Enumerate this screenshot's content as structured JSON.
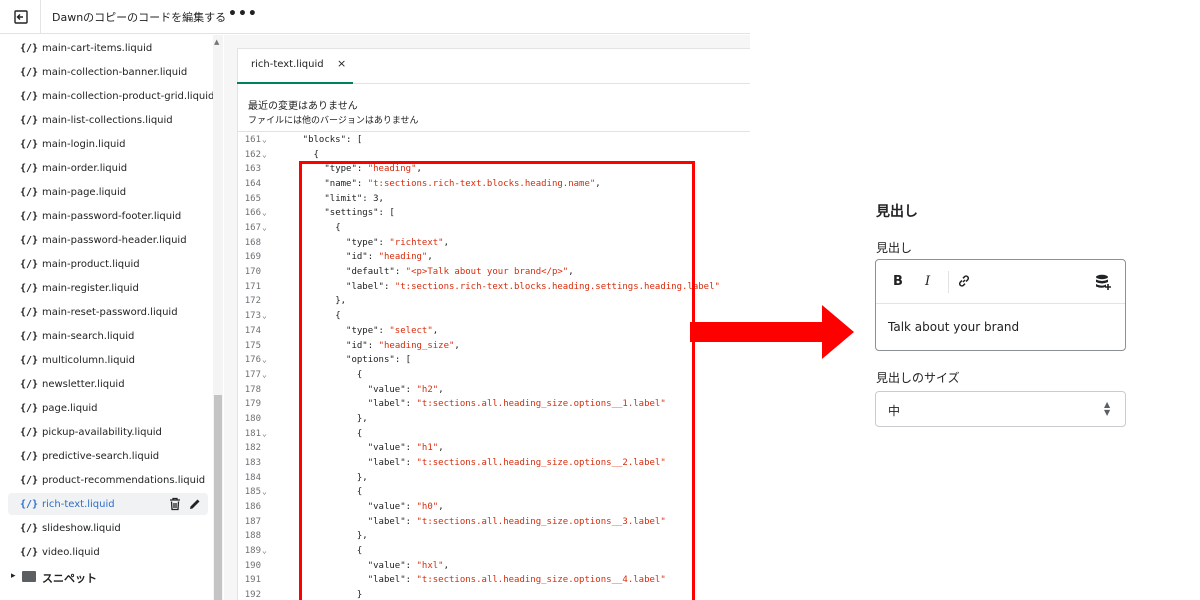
{
  "topbar": {
    "title": "Dawnのコピーのコードを編集する",
    "more": "•••"
  },
  "sidebar": {
    "files": [
      {
        "icon": "{/}",
        "label": "main-cart-items.liquid"
      },
      {
        "icon": "{/}",
        "label": "main-collection-banner.liquid"
      },
      {
        "icon": "{/}",
        "label": "main-collection-product-grid.liquid"
      },
      {
        "icon": "{/}",
        "label": "main-list-collections.liquid"
      },
      {
        "icon": "{/}",
        "label": "main-login.liquid"
      },
      {
        "icon": "{/}",
        "label": "main-order.liquid"
      },
      {
        "icon": "{/}",
        "label": "main-page.liquid"
      },
      {
        "icon": "{/}",
        "label": "main-password-footer.liquid"
      },
      {
        "icon": "{/}",
        "label": "main-password-header.liquid"
      },
      {
        "icon": "{/}",
        "label": "main-product.liquid"
      },
      {
        "icon": "{/}",
        "label": "main-register.liquid"
      },
      {
        "icon": "{/}",
        "label": "main-reset-password.liquid"
      },
      {
        "icon": "{/}",
        "label": "main-search.liquid"
      },
      {
        "icon": "{/}",
        "label": "multicolumn.liquid"
      },
      {
        "icon": "{/}",
        "label": "newsletter.liquid"
      },
      {
        "icon": "{/}",
        "label": "page.liquid"
      },
      {
        "icon": "{/}",
        "label": "pickup-availability.liquid"
      },
      {
        "icon": "{/}",
        "label": "predictive-search.liquid"
      },
      {
        "icon": "{/}",
        "label": "product-recommendations.liquid"
      },
      {
        "icon": "{/}",
        "label": "rich-text.liquid",
        "active": true
      },
      {
        "icon": "{/}",
        "label": "slideshow.liquid"
      },
      {
        "icon": "{/}",
        "label": "video.liquid"
      }
    ],
    "folder": {
      "label": "スニペット",
      "caret": "▸"
    }
  },
  "editor": {
    "tab_label": "rich-text.liquid",
    "tab_close": "×",
    "notice_title": "最近の変更はありません",
    "notice_sub": "ファイルには他のバージョンはありません",
    "lines": [
      {
        "n": "161",
        "fold": true,
        "indent": 4,
        "parts": [
          [
            "k",
            "\"blocks\""
          ],
          [
            "p",
            ": ["
          ]
        ]
      },
      {
        "n": "162",
        "fold": true,
        "indent": 6,
        "parts": [
          [
            "p",
            "{"
          ]
        ]
      },
      {
        "n": "163",
        "fold": false,
        "indent": 8,
        "parts": [
          [
            "k",
            "\"type\""
          ],
          [
            "p",
            ": "
          ],
          [
            "s",
            "\"heading\""
          ],
          [
            "p",
            ","
          ]
        ]
      },
      {
        "n": "164",
        "fold": false,
        "indent": 8,
        "parts": [
          [
            "k",
            "\"name\""
          ],
          [
            "p",
            ": "
          ],
          [
            "s",
            "\"t:sections.rich-text.blocks.heading.name\""
          ],
          [
            "p",
            ","
          ]
        ]
      },
      {
        "n": "165",
        "fold": false,
        "indent": 8,
        "parts": [
          [
            "k",
            "\"limit\""
          ],
          [
            "p",
            ": 3,"
          ]
        ]
      },
      {
        "n": "166",
        "fold": true,
        "indent": 8,
        "parts": [
          [
            "k",
            "\"settings\""
          ],
          [
            "p",
            ": ["
          ]
        ]
      },
      {
        "n": "167",
        "fold": true,
        "indent": 10,
        "parts": [
          [
            "p",
            "{"
          ]
        ]
      },
      {
        "n": "168",
        "fold": false,
        "indent": 12,
        "parts": [
          [
            "k",
            "\"type\""
          ],
          [
            "p",
            ": "
          ],
          [
            "s",
            "\"richtext\""
          ],
          [
            "p",
            ","
          ]
        ]
      },
      {
        "n": "169",
        "fold": false,
        "indent": 12,
        "parts": [
          [
            "k",
            "\"id\""
          ],
          [
            "p",
            ": "
          ],
          [
            "s",
            "\"heading\""
          ],
          [
            "p",
            ","
          ]
        ]
      },
      {
        "n": "170",
        "fold": false,
        "indent": 12,
        "parts": [
          [
            "k",
            "\"default\""
          ],
          [
            "p",
            ": "
          ],
          [
            "s",
            "\"<p>Talk about your brand</p>\""
          ],
          [
            "p",
            ","
          ]
        ]
      },
      {
        "n": "171",
        "fold": false,
        "indent": 12,
        "parts": [
          [
            "k",
            "\"label\""
          ],
          [
            "p",
            ": "
          ],
          [
            "s",
            "\"t:sections.rich-text.blocks.heading.settings.heading.label\""
          ]
        ]
      },
      {
        "n": "172",
        "fold": false,
        "indent": 10,
        "parts": [
          [
            "p",
            "},"
          ]
        ]
      },
      {
        "n": "173",
        "fold": true,
        "indent": 10,
        "parts": [
          [
            "p",
            "{"
          ]
        ]
      },
      {
        "n": "174",
        "fold": false,
        "indent": 12,
        "parts": [
          [
            "k",
            "\"type\""
          ],
          [
            "p",
            ": "
          ],
          [
            "s",
            "\"select\""
          ],
          [
            "p",
            ","
          ]
        ]
      },
      {
        "n": "175",
        "fold": false,
        "indent": 12,
        "parts": [
          [
            "k",
            "\"id\""
          ],
          [
            "p",
            ": "
          ],
          [
            "s",
            "\"heading_size\""
          ],
          [
            "p",
            ","
          ]
        ]
      },
      {
        "n": "176",
        "fold": true,
        "indent": 12,
        "parts": [
          [
            "k",
            "\"options\""
          ],
          [
            "p",
            ": ["
          ]
        ]
      },
      {
        "n": "177",
        "fold": true,
        "indent": 14,
        "parts": [
          [
            "p",
            "{"
          ]
        ]
      },
      {
        "n": "178",
        "fold": false,
        "indent": 16,
        "parts": [
          [
            "k",
            "\"value\""
          ],
          [
            "p",
            ": "
          ],
          [
            "s",
            "\"h2\""
          ],
          [
            "p",
            ","
          ]
        ]
      },
      {
        "n": "179",
        "fold": false,
        "indent": 16,
        "parts": [
          [
            "k",
            "\"label\""
          ],
          [
            "p",
            ": "
          ],
          [
            "s",
            "\"t:sections.all.heading_size.options__1.label\""
          ]
        ]
      },
      {
        "n": "180",
        "fold": false,
        "indent": 14,
        "parts": [
          [
            "p",
            "},"
          ]
        ]
      },
      {
        "n": "181",
        "fold": true,
        "indent": 14,
        "parts": [
          [
            "p",
            "{"
          ]
        ]
      },
      {
        "n": "182",
        "fold": false,
        "indent": 16,
        "parts": [
          [
            "k",
            "\"value\""
          ],
          [
            "p",
            ": "
          ],
          [
            "s",
            "\"h1\""
          ],
          [
            "p",
            ","
          ]
        ]
      },
      {
        "n": "183",
        "fold": false,
        "indent": 16,
        "parts": [
          [
            "k",
            "\"label\""
          ],
          [
            "p",
            ": "
          ],
          [
            "s",
            "\"t:sections.all.heading_size.options__2.label\""
          ]
        ]
      },
      {
        "n": "184",
        "fold": false,
        "indent": 14,
        "parts": [
          [
            "p",
            "},"
          ]
        ]
      },
      {
        "n": "185",
        "fold": true,
        "indent": 14,
        "parts": [
          [
            "p",
            "{"
          ]
        ]
      },
      {
        "n": "186",
        "fold": false,
        "indent": 16,
        "parts": [
          [
            "k",
            "\"value\""
          ],
          [
            "p",
            ": "
          ],
          [
            "s",
            "\"h0\""
          ],
          [
            "p",
            ","
          ]
        ]
      },
      {
        "n": "187",
        "fold": false,
        "indent": 16,
        "parts": [
          [
            "k",
            "\"label\""
          ],
          [
            "p",
            ": "
          ],
          [
            "s",
            "\"t:sections.all.heading_size.options__3.label\""
          ]
        ]
      },
      {
        "n": "188",
        "fold": false,
        "indent": 14,
        "parts": [
          [
            "p",
            "},"
          ]
        ]
      },
      {
        "n": "189",
        "fold": true,
        "indent": 14,
        "parts": [
          [
            "p",
            "{"
          ]
        ]
      },
      {
        "n": "190",
        "fold": false,
        "indent": 16,
        "parts": [
          [
            "k",
            "\"value\""
          ],
          [
            "p",
            ": "
          ],
          [
            "s",
            "\"hxl\""
          ],
          [
            "p",
            ","
          ]
        ]
      },
      {
        "n": "191",
        "fold": false,
        "indent": 16,
        "parts": [
          [
            "k",
            "\"label\""
          ],
          [
            "p",
            ": "
          ],
          [
            "s",
            "\"t:sections.all.heading_size.options__4.label\""
          ]
        ]
      },
      {
        "n": "192",
        "fold": false,
        "indent": 14,
        "parts": [
          [
            "p",
            "}"
          ]
        ]
      }
    ]
  },
  "preview": {
    "section_heading": "見出し",
    "heading_field_label": "見出し",
    "toolbar": {
      "bold": "B",
      "italic": "I"
    },
    "heading_value": "Talk about your brand",
    "size_field_label": "見出しのサイズ",
    "size_value": "中"
  },
  "colors": {
    "highlight": "#ff0000",
    "arrow": "#ff0000",
    "active_file": "#2c6ecb",
    "code_string": "#d72c0d",
    "tab_underline": "#008060"
  },
  "icons": {
    "back": "exit-icon",
    "trash": "trash-icon",
    "edit": "pencil-icon",
    "link": "link-icon",
    "dynamic_source": "database-icon",
    "chevron": "select-chevron-icon"
  }
}
